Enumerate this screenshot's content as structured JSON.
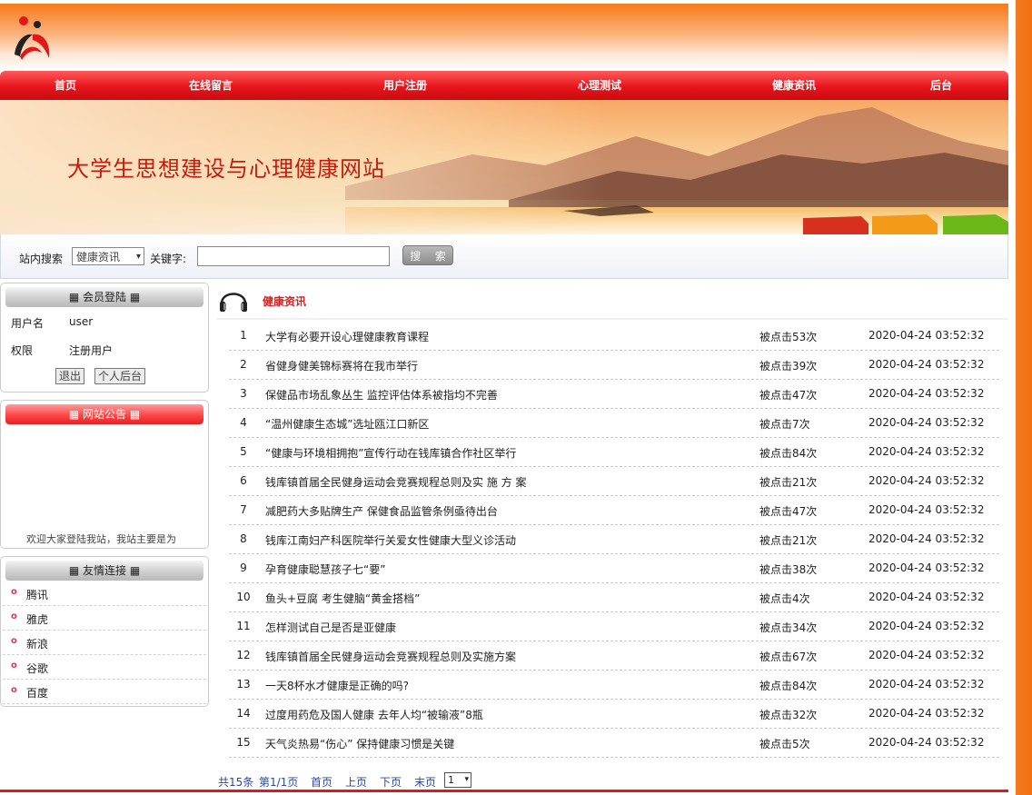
{
  "nav": [
    "首页",
    "在线留言",
    "用户注册",
    "心理测试",
    "健康资讯",
    "后台"
  ],
  "banner": {
    "title": "大学生思想建设与心理健康网站"
  },
  "search": {
    "site_label": "站内搜索",
    "category": "健康资讯",
    "keyword_label": "关键字:",
    "keyword_value": "",
    "button": "搜 索"
  },
  "login": {
    "title": "会员登陆",
    "username_label": "用户名",
    "username": "user",
    "role_label": "权限",
    "role": "注册用户",
    "logout": "退出",
    "backend": "个人后台"
  },
  "notice": {
    "title": "网站公告",
    "text": "欢迎大家登陆我站，我站主要是为"
  },
  "links": {
    "title": "友情连接",
    "items": [
      "腾讯",
      "雅虎",
      "新浪",
      "谷歌",
      "百度"
    ]
  },
  "content": {
    "title": "健康资讯",
    "rows": [
      {
        "num": "1",
        "title": "大学有必要开设心理健康教育课程",
        "clicks": "被点击53次",
        "date": "2020-04-24 03:52:32"
      },
      {
        "num": "2",
        "title": "省健身健美锦标赛将在我市举行",
        "clicks": "被点击39次",
        "date": "2020-04-24 03:52:32"
      },
      {
        "num": "3",
        "title": "保健品市场乱象丛生 监控评估体系被指均不完善",
        "clicks": "被点击47次",
        "date": "2020-04-24 03:52:32"
      },
      {
        "num": "4",
        "title": "“温州健康生态城”选址瓯江口新区",
        "clicks": "被点击7次",
        "date": "2020-04-24 03:52:32"
      },
      {
        "num": "5",
        "title": "“健康与环境相拥抱”宣传行动在钱库镇合作社区举行",
        "clicks": "被点击84次",
        "date": "2020-04-24 03:52:32"
      },
      {
        "num": "6",
        "title": "钱库镇首届全民健身运动会竞赛规程总则及实 施 方 案",
        "clicks": "被点击21次",
        "date": "2020-04-24 03:52:32"
      },
      {
        "num": "7",
        "title": "减肥药大多贴牌生产 保健食品监管条例亟待出台",
        "clicks": "被点击47次",
        "date": "2020-04-24 03:52:32"
      },
      {
        "num": "8",
        "title": "钱库江南妇产科医院举行关爱女性健康大型义诊活动",
        "clicks": "被点击21次",
        "date": "2020-04-24 03:52:32"
      },
      {
        "num": "9",
        "title": "孕育健康聪慧孩子七“要”",
        "clicks": "被点击38次",
        "date": "2020-04-24 03:52:32"
      },
      {
        "num": "10",
        "title": "鱼头+豆腐 考生健脑“黄金搭档”",
        "clicks": "被点击4次",
        "date": "2020-04-24 03:52:32"
      },
      {
        "num": "11",
        "title": "怎样测试自己是否是亚健康",
        "clicks": "被点击34次",
        "date": "2020-04-24 03:52:32"
      },
      {
        "num": "12",
        "title": "钱库镇首届全民健身运动会竞赛规程总则及实施方案",
        "clicks": "被点击67次",
        "date": "2020-04-24 03:52:32"
      },
      {
        "num": "13",
        "title": "一天8杯水才健康是正确的吗?",
        "clicks": "被点击84次",
        "date": "2020-04-24 03:52:32"
      },
      {
        "num": "14",
        "title": "过度用药危及国人健康 去年人均“被输液”8瓶",
        "clicks": "被点击32次",
        "date": "2020-04-24 03:52:32"
      },
      {
        "num": "15",
        "title": "天气炎热易“伤心” 保持健康习惯是关键",
        "clicks": "被点击5次",
        "date": "2020-04-24 03:52:32"
      }
    ]
  },
  "pager": {
    "total": "共15条",
    "page": "第1/1页",
    "first": "首页",
    "prev": "上页",
    "next": "下页",
    "last": "末页",
    "select": "1"
  },
  "colors": {
    "nav": "#e8141c",
    "accent": "#f47a1e",
    "title": "#d42020"
  },
  "icons": [
    "logo-icon",
    "headphone-icon",
    "bullet-icon",
    "chevron-down-icon"
  ]
}
